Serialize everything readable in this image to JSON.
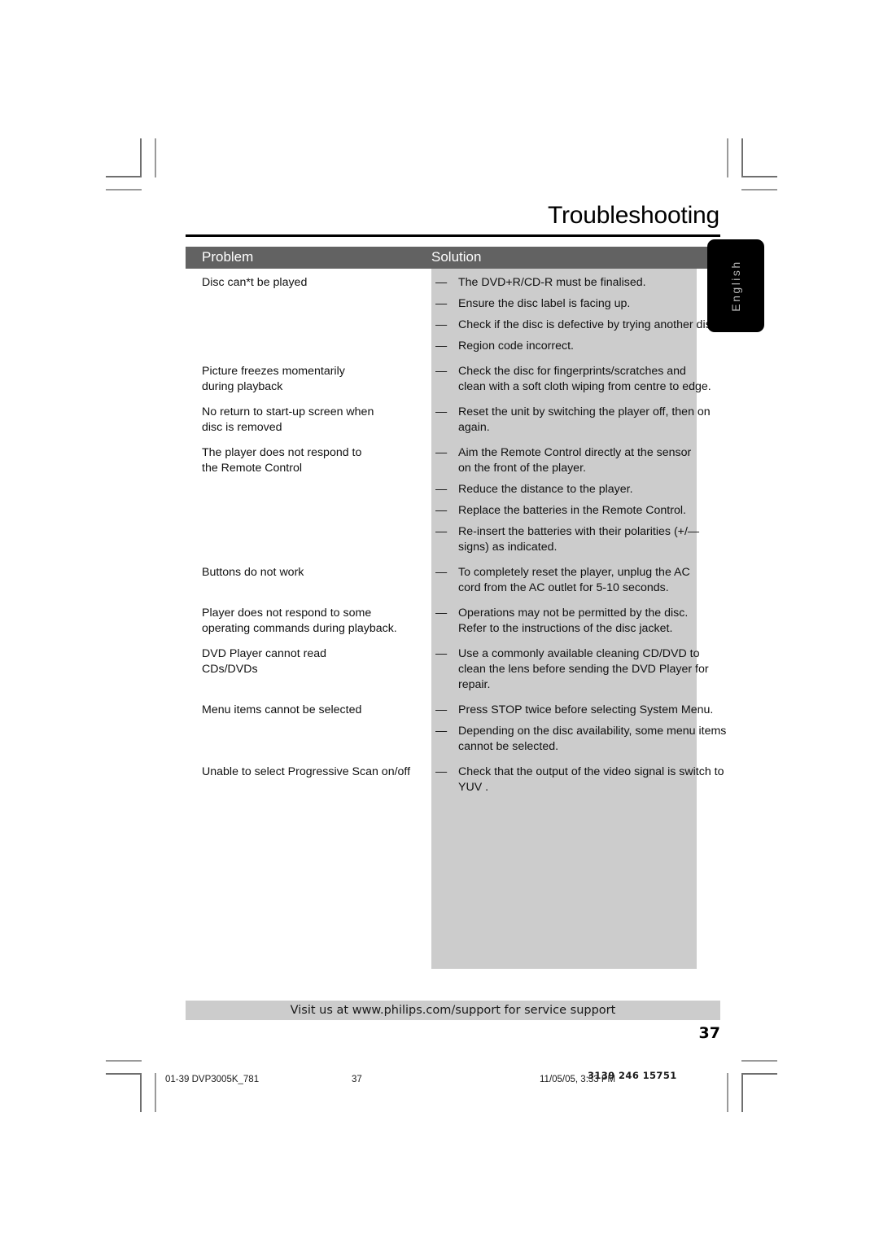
{
  "document": {
    "title": "Troubleshooting",
    "side_tab_label": "English",
    "page_number": "37",
    "support_banner": "Visit us at www.philips.com/support for service support"
  },
  "table": {
    "headers": {
      "problem": "Problem",
      "solution": "Solution"
    },
    "header_bg": "#626262",
    "solution_bg": "#cccccc",
    "rows": [
      {
        "problem": [
          "Disc can*t be played"
        ],
        "solutions": [
          [
            "The DVD+R/CD-R must be finalised."
          ],
          [
            "Ensure the disc label is facing up."
          ],
          [
            "Check if the disc is defective by trying another disc."
          ],
          [
            "Region code incorrect."
          ]
        ]
      },
      {
        "problem": [
          "Picture freezes momentarily",
          "during playback"
        ],
        "solutions": [
          [
            "Check the disc for fingerprints/scratches and",
            "clean with a soft cloth wiping from centre to edge."
          ]
        ]
      },
      {
        "problem": [
          "No return to start-up screen when",
          "disc is removed"
        ],
        "solutions": [
          [
            "Reset the unit by switching the player off, then on",
            "again."
          ]
        ]
      },
      {
        "problem": [
          "The player does not respond to",
          "the Remote Control"
        ],
        "solutions": [
          [
            "Aim the Remote Control directly at the sensor",
            "on the front of the player."
          ],
          [
            "Reduce the distance to the player."
          ],
          [
            "Replace the batteries in the Remote Control."
          ],
          [
            "Re-insert the batteries with their polarities (+/—",
            "signs) as indicated."
          ]
        ]
      },
      {
        "problem": [
          "Buttons do not work"
        ],
        "solutions": [
          [
            "To completely reset the player, unplug the AC",
            "cord from the AC outlet for 5-10 seconds."
          ]
        ]
      },
      {
        "problem": [
          "Player does not respond to some",
          "operating commands during playback."
        ],
        "solutions": [
          [
            "Operations may not be permitted by the disc.",
            "Refer to the instructions of  the disc jacket."
          ]
        ]
      },
      {
        "problem": [
          "DVD Player cannot read",
          "CDs/DVDs"
        ],
        "solutions": [
          [
            "Use a commonly available cleaning CD/DVD to",
            "clean the lens before sending the DVD Player for",
            "repair."
          ]
        ]
      },
      {
        "problem": [
          "Menu items cannot be selected"
        ],
        "solutions": [
          [
            "Press STOP twice before selecting System Menu."
          ],
          [
            "Depending on the disc availability, some menu items",
            "cannot be selected."
          ]
        ]
      },
      {
        "problem": [
          "Unable to select Progressive Scan on/off"
        ],
        "solutions": [
          [
            "Check that the output of the video signal is switch to",
            "YUV ."
          ]
        ]
      }
    ],
    "bullet_dash": "—"
  },
  "printer_footer": {
    "file": "01-39 DVP3005K_781",
    "page": "37",
    "date": "11/05/05, 3:33 PM",
    "part_number": "3139 246 15751"
  }
}
